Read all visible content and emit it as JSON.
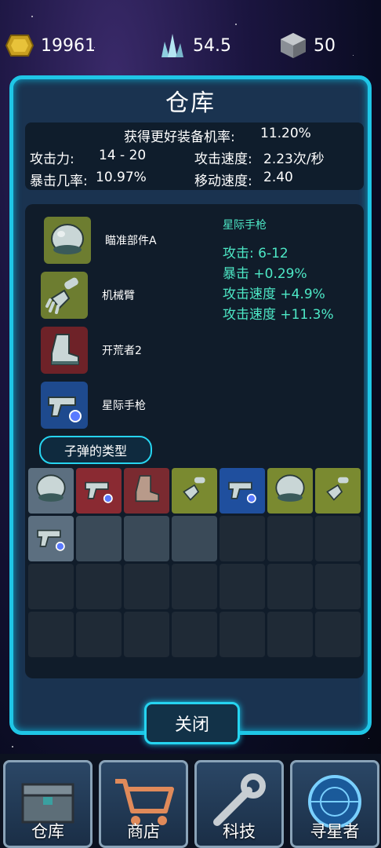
{
  "resources": {
    "gold": "19961",
    "crystal": "54.5",
    "metal": "50"
  },
  "panel": {
    "title": "仓库",
    "stats": {
      "better_rate_label": "获得更好装备机率:",
      "better_rate_value": "11.20%",
      "attack_label": "攻击力:",
      "attack_value": "14 - 20",
      "attack_speed_label": "攻击速度:",
      "attack_speed_value": "2.23次/秒",
      "crit_label": "暴击几率:",
      "crit_value": "10.97%",
      "move_speed_label": "移动速度:",
      "move_speed_value": "2.40"
    },
    "equipment": [
      {
        "name": "瞄准部件A",
        "icon": "helmet-icon"
      },
      {
        "name": "机械臂",
        "icon": "robot-arm-icon"
      },
      {
        "name": "开荒者2",
        "icon": "boot-icon"
      },
      {
        "name": "星际手枪",
        "icon": "pistol-icon"
      }
    ],
    "detail": {
      "name": "星际手枪",
      "lines": [
        "攻击: 6-12",
        "暴击 +0.29%",
        "攻击速度 +4.9%",
        "攻击速度 +11.3%"
      ]
    },
    "bullet_type_button": "子弹的类型",
    "inventory": [
      {
        "icon": "helmet-icon",
        "bg": "#5c6f80"
      },
      {
        "icon": "pistol-icon",
        "bg": "#8a2a32"
      },
      {
        "icon": "boot-icon",
        "bg": "#7a2a30"
      },
      {
        "icon": "robot-arm-icon",
        "bg": "#7a8a30"
      },
      {
        "icon": "pistol-icon",
        "bg": "#1f4f9e"
      },
      {
        "icon": "helmet-icon",
        "bg": "#7a8a30"
      },
      {
        "icon": "robot-arm-icon",
        "bg": "#7a8a30"
      },
      {
        "icon": "pistol-icon",
        "bg": "#5c6f80"
      },
      {
        "icon": "",
        "bg": "#3a4a58"
      },
      {
        "icon": "",
        "bg": "#3a4a58"
      },
      {
        "icon": "",
        "bg": "#3a4a58"
      },
      {
        "icon": "",
        "bg": "#1f2a36"
      },
      {
        "icon": "",
        "bg": "#1f2a36"
      },
      {
        "icon": "",
        "bg": "#1f2a36"
      },
      {
        "icon": "",
        "bg": "#1f2a36"
      },
      {
        "icon": "",
        "bg": "#1f2a36"
      },
      {
        "icon": "",
        "bg": "#1f2a36"
      },
      {
        "icon": "",
        "bg": "#1f2a36"
      },
      {
        "icon": "",
        "bg": "#1f2a36"
      },
      {
        "icon": "",
        "bg": "#1f2a36"
      },
      {
        "icon": "",
        "bg": "#1f2a36"
      },
      {
        "icon": "",
        "bg": "#1f2a36"
      },
      {
        "icon": "",
        "bg": "#1f2a36"
      },
      {
        "icon": "",
        "bg": "#1f2a36"
      },
      {
        "icon": "",
        "bg": "#1f2a36"
      },
      {
        "icon": "",
        "bg": "#1f2a36"
      },
      {
        "icon": "",
        "bg": "#1f2a36"
      },
      {
        "icon": "",
        "bg": "#1f2a36"
      }
    ],
    "close_button": "关闭"
  },
  "tabs": [
    {
      "label": "仓库",
      "icon": "chest-icon"
    },
    {
      "label": "商店",
      "icon": "cart-icon"
    },
    {
      "label": "科技",
      "icon": "wrench-icon"
    },
    {
      "label": "寻星者",
      "icon": "radar-icon"
    }
  ],
  "colors": {
    "accent": "#1fc6e6",
    "stat_green": "#4de8c6"
  }
}
